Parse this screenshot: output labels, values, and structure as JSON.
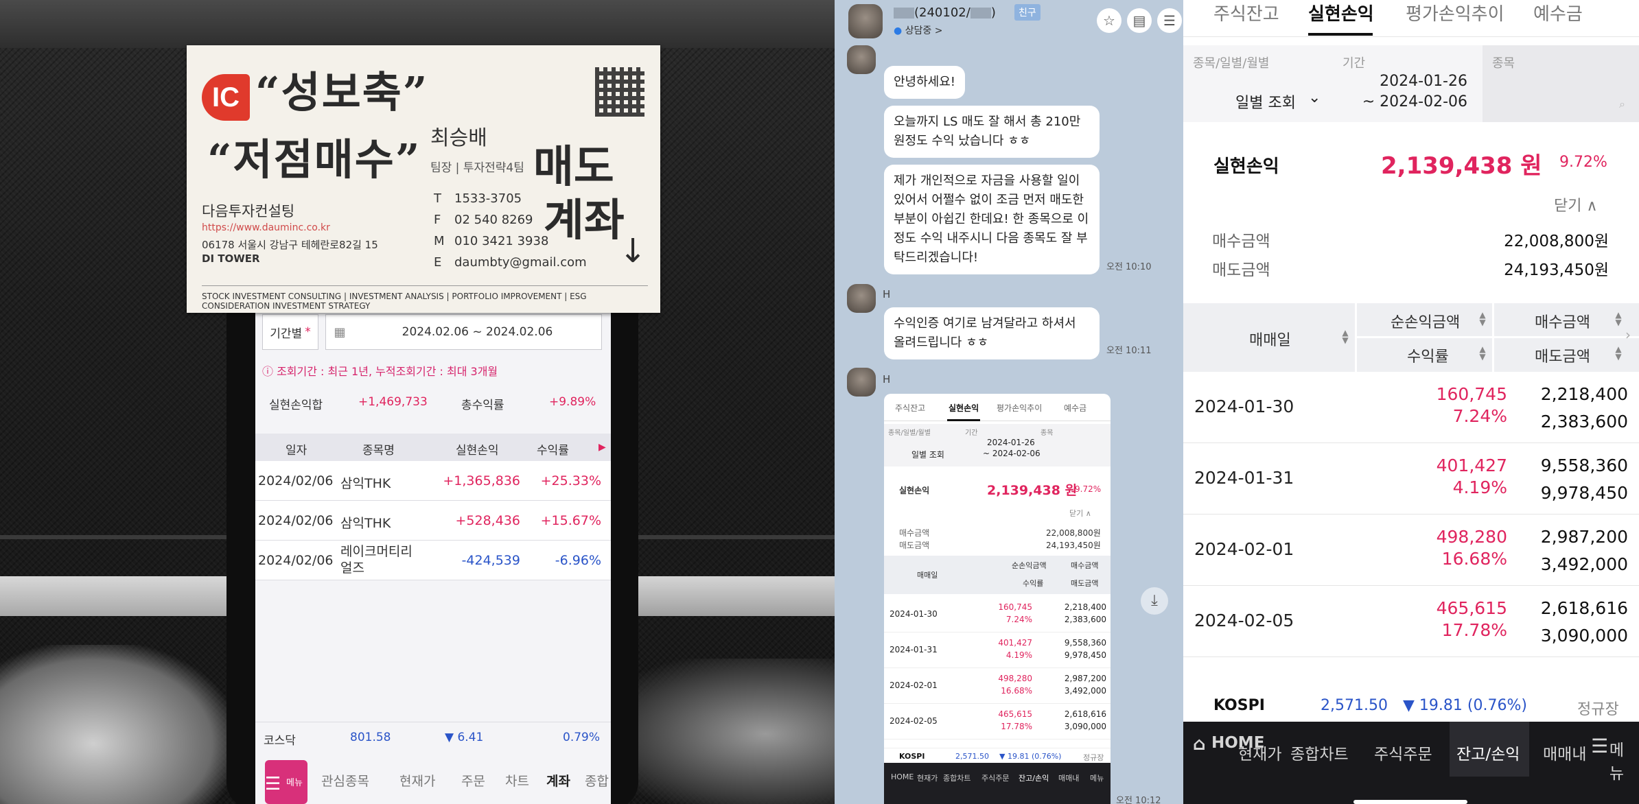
{
  "card": {
    "logo": "IC",
    "hand_line1": "“성보축”",
    "hand_line2": "“저점매수”",
    "hand_right1": "매도",
    "hand_right2": "계좌",
    "name": "최승배",
    "title": "팀장 | 투자전략4팀",
    "company": "다음투자컨설팅",
    "url": "https://www.dauminc.co.kr",
    "address": "06178 서울시 강남구 테헤란로82길 15",
    "building": "DI TOWER",
    "contacts": [
      {
        "k": "T",
        "v": "1533-3705"
      },
      {
        "k": "F",
        "v": "02 540 8269"
      },
      {
        "k": "M",
        "v": "010 3421 3938"
      },
      {
        "k": "E",
        "v": "daumbty@gmail.com"
      }
    ],
    "footer": "STOCK INVESTMENT CONSULTING | INVESTMENT ANALYSIS | PORTFOLIO IMPROVEMENT | ESG CONSIDERATION INVESTMENT STRATEGY"
  },
  "phone": {
    "period_label": "기간별",
    "period_star": "*",
    "date_range": "2024.02.06 ~ 2024.02.06",
    "notice": "ⓘ 조회기간 : 최근 1년, 누적조회기간 : 최대 3개월",
    "summary_label": "실현손익합",
    "summary_value": "+1,469,733",
    "total_rate_label": "총수익률",
    "total_rate_value": "+9.89%",
    "headers": [
      "일자",
      "종목명",
      "실현손익",
      "수익률"
    ],
    "rows": [
      {
        "date": "2024/02/06",
        "name": "삼익THK",
        "pl": "+1,365,836",
        "rate": "+25.33%",
        "sign": "pos"
      },
      {
        "date": "2024/02/06",
        "name": "삼익THK",
        "pl": "+528,436",
        "rate": "+15.67%",
        "sign": "pos"
      },
      {
        "date": "2024/02/06",
        "name": "레이크머티리얼즈",
        "pl": "-424,539",
        "rate": "-6.96%",
        "sign": "neg"
      }
    ],
    "index_name": "코스닥",
    "index_value": "801.58",
    "index_change": "▼ 6.41",
    "index_pct": "0.79%",
    "menu_label": "메뉴",
    "nav": [
      "관심종목",
      "현재가",
      "주문",
      "차트",
      "계좌",
      "종합"
    ]
  },
  "chat": {
    "contact_name": "(240102/",
    "contact_name_end": ")",
    "friend_badge": "친구",
    "status": "상담중 >",
    "sender": "H",
    "messages": [
      "안녕하세요!",
      "오늘까지 LS 매도 잘 해서 총 210만 원정도 수익 났습니다 ㅎㅎ",
      "제가 개인적으로 자금을 사용할 일이 있어서 어쩔수 없이 조금 먼저 매도한 부분이 아쉽긴 한데요! 한 종목으로 이정도 수익 내주시니 다음 종목도 잘 부탁드리겠습니다!",
      "수익인증 여기로 남겨달라고 하셔서 올려드립니다 ㅎㅎ"
    ],
    "times": [
      "오전 10:10",
      "오전 10:11",
      "오전 10:12"
    ]
  },
  "app": {
    "tabs": [
      "주식잔고",
      "실현손익",
      "평가손익추이",
      "예수금"
    ],
    "active_tab": 1,
    "filter_label1": "종목/일별/월별",
    "filter_value1": "일별 조회",
    "filter_label2": "기간",
    "date_from": "2024-01-26",
    "date_to": "~ 2024-02-06",
    "filter_label3": "종목",
    "realized_label": "실현손익",
    "realized_value": "2,139,438 원",
    "realized_pct": "9.72%",
    "close_label": "닫기 ∧",
    "buy_label": "매수금액",
    "buy_value": "22,008,800원",
    "sell_label": "매도금액",
    "sell_value": "24,193,450원",
    "th_date": "매매일",
    "th_net": "순손익금액",
    "th_rate": "수익률",
    "th_buy": "매수금액",
    "th_sell": "매도금액",
    "rows": [
      {
        "date": "2024-01-30",
        "net": "160,745",
        "rate": "7.24%",
        "buy": "2,218,400",
        "sell": "2,383,600"
      },
      {
        "date": "2024-01-31",
        "net": "401,427",
        "rate": "4.19%",
        "buy": "9,558,360",
        "sell": "9,978,450"
      },
      {
        "date": "2024-02-01",
        "net": "498,280",
        "rate": "16.68%",
        "buy": "2,987,200",
        "sell": "3,492,000"
      },
      {
        "date": "2024-02-05",
        "net": "465,615",
        "rate": "17.78%",
        "buy": "2,618,616",
        "sell": "3,090,000"
      }
    ],
    "kospi_label": "KOSPI",
    "kospi_value": "2,571.50",
    "kospi_change": "▼ 19.81 (0.76%)",
    "market_status": "정규장",
    "nav_home": "HOME",
    "nav_items": [
      "현재가",
      "종합차트",
      "주식주문",
      "잔고/손익",
      "매매내"
    ],
    "nav_menu": "메뉴",
    "kospi_short": "KOSPI",
    "kospi_change_short": "▼ 19.81 (0.76%)"
  },
  "colors": {
    "accent_red": "#e0245e",
    "accent_blue": "#2a54c8",
    "chat_bg": "#bccbdb"
  }
}
